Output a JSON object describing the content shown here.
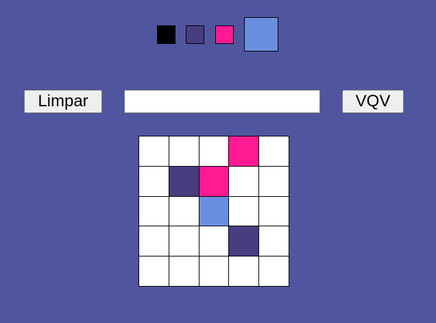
{
  "palette": {
    "colors": [
      "#000000",
      "#483d7f",
      "#ff1a94",
      "#6b8fe0"
    ],
    "selected_index": 3
  },
  "controls": {
    "clear_label": "Limpar",
    "input_value": "",
    "generate_label": "VQV"
  },
  "board": {
    "size": 5,
    "cells": [
      [
        "#ffffff",
        "#ffffff",
        "#ffffff",
        "#ff1a94",
        "#ffffff"
      ],
      [
        "#ffffff",
        "#483d7f",
        "#ff1a94",
        "#ffffff",
        "#ffffff"
      ],
      [
        "#ffffff",
        "#ffffff",
        "#6b8fe0",
        "#ffffff",
        "#ffffff"
      ],
      [
        "#ffffff",
        "#ffffff",
        "#ffffff",
        "#483d7f",
        "#ffffff"
      ],
      [
        "#ffffff",
        "#ffffff",
        "#ffffff",
        "#ffffff",
        "#ffffff"
      ]
    ]
  }
}
